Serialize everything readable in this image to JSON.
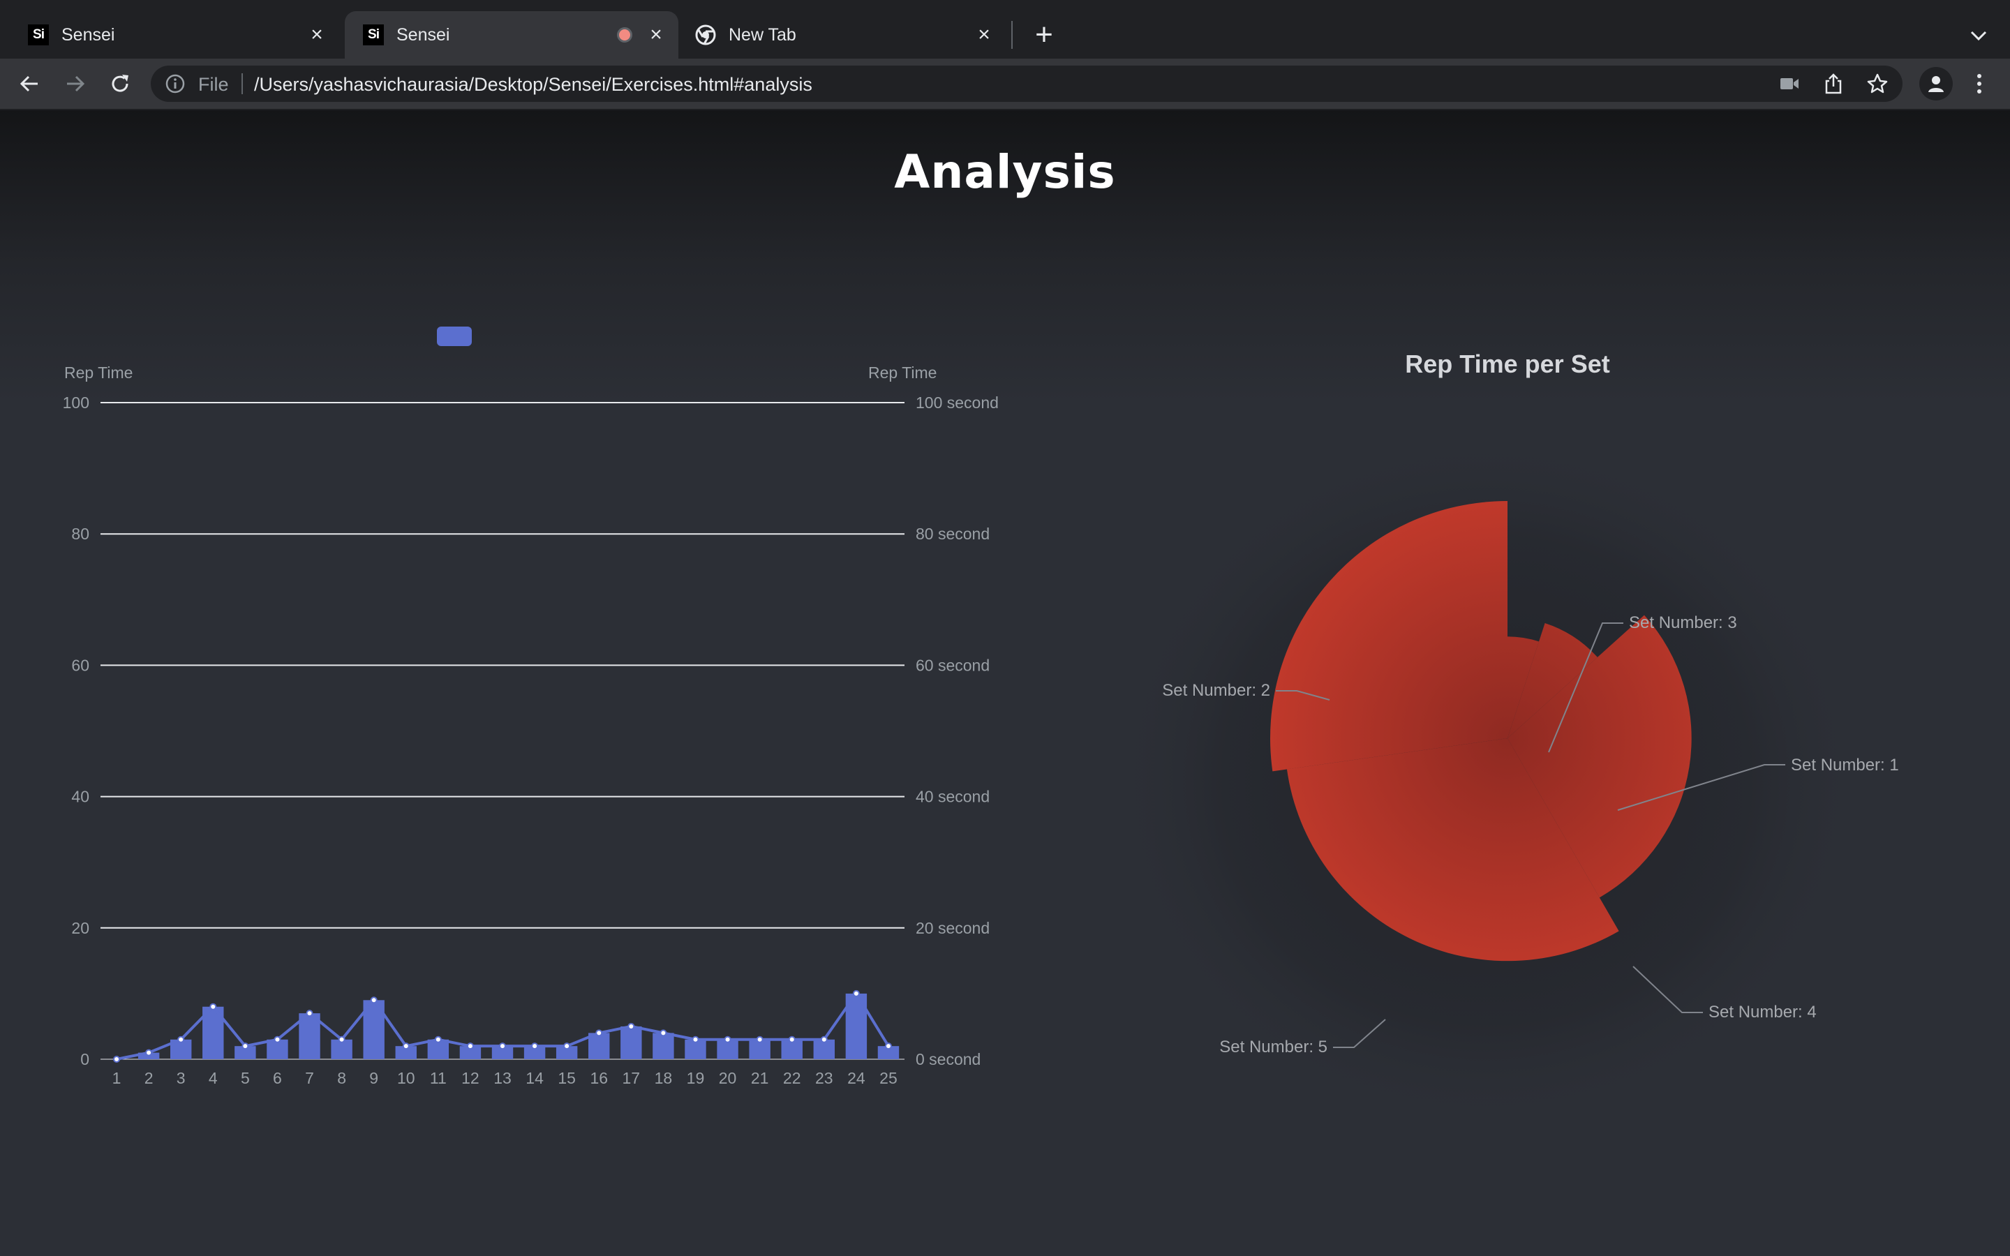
{
  "browser": {
    "tabs": [
      {
        "title": "Sensei",
        "favicon": "Si",
        "active": false
      },
      {
        "title": "Sensei",
        "favicon": "Si",
        "active": true,
        "recording": true
      },
      {
        "title": "New Tab",
        "favicon": "chrome-icon",
        "active": false
      }
    ],
    "omnibox": {
      "scheme_label": "File",
      "url": "/Users/yashasvichaurasia/Desktop/Sensei/Exercises.html#analysis"
    }
  },
  "page": {
    "title": "Analysis"
  },
  "colors": {
    "bar": "#5b6fcf",
    "pie": "#c0392b",
    "background": "#2c2f36",
    "axis_text": "#9aa0a6"
  },
  "chart_data": [
    {
      "type": "bar",
      "categories": [
        "1",
        "2",
        "3",
        "4",
        "5",
        "6",
        "7",
        "8",
        "9",
        "10",
        "11",
        "12",
        "13",
        "14",
        "15",
        "16",
        "17",
        "18",
        "19",
        "20",
        "21",
        "22",
        "23",
        "24",
        "25"
      ],
      "series": [
        {
          "values": [
            0,
            1,
            3,
            8,
            2,
            3,
            7,
            3,
            9,
            2,
            3,
            2,
            2,
            2,
            2,
            4,
            5,
            4,
            3,
            3,
            3,
            3,
            3,
            10,
            2
          ]
        },
        {
          "type": "line",
          "values": [
            0,
            1,
            3,
            8,
            2,
            3,
            7,
            3,
            9,
            2,
            3,
            2,
            2,
            2,
            2,
            4,
            5,
            4,
            3,
            3,
            3,
            3,
            3,
            10,
            2
          ]
        }
      ],
      "ylabel_left": "Rep Time",
      "ylabel_right": "Rep Time",
      "ylim": [
        0,
        100
      ],
      "yticks_left": [
        "0",
        "20",
        "40",
        "60",
        "80",
        "100"
      ],
      "yticks_right": [
        "0 second",
        "20 second",
        "40 second",
        "60 second",
        "80 second",
        "100 second"
      ],
      "grid": true,
      "legend": "top-center"
    },
    {
      "type": "pie",
      "subtype": "rose",
      "title": "Rep Time per Set",
      "labels": [
        "Set Number: 1",
        "Set Number: 2",
        "Set Number: 3",
        "Set Number: 4",
        "Set Number: 5"
      ],
      "values": [
        2.5,
        4.9,
        2.1,
        3.8,
        4.6
      ],
      "legend": "none"
    }
  ]
}
